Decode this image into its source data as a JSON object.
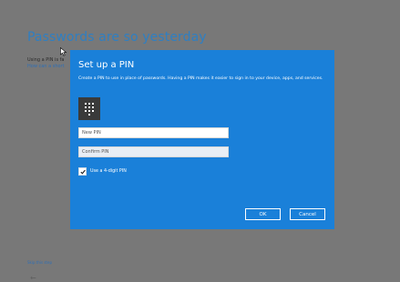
{
  "background": {
    "title": "Passwords are so yesterday",
    "line1": "Using a PIN is fa",
    "line2": "How can a short",
    "skip_link": "Skip this step"
  },
  "dialog": {
    "title": "Set up a PIN",
    "description": "Create a PIN to use in place of passwords. Having a PIN makes it easier to sign in to your device, apps, and services.",
    "new_pin": {
      "value": "",
      "placeholder": "New PIN"
    },
    "confirm_pin": {
      "value": "",
      "placeholder": "Confirm PIN"
    },
    "use_4_digit": {
      "label": "Use a 4-digit PIN",
      "checked": true
    },
    "ok_label": "OK",
    "cancel_label": "Cancel"
  },
  "colors": {
    "dialog_bg": "#1a80d9",
    "page_bg": "#7b7b7b",
    "title_blue": "#2f7fc2",
    "keypad_tile": "#3a3a3a"
  },
  "icons": [
    "keypad-icon",
    "checkmark-icon",
    "mouse-cursor-icon",
    "back-arrow-icon"
  ]
}
